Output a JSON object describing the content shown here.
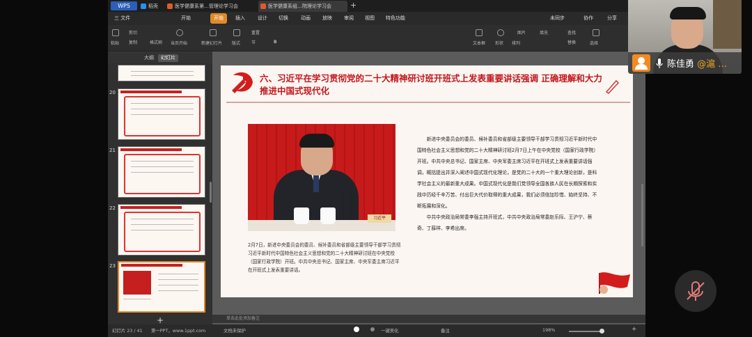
{
  "app_tab": "WPS",
  "tabs": [
    {
      "label": "稻壳",
      "icon_color": "#2b8ef0"
    },
    {
      "label": "医学健康系第…管理论学习会",
      "icon_color": "#e05a2b"
    },
    {
      "label": "医学健康系组…院理论学习会",
      "icon_color": "#e05a2b"
    }
  ],
  "menu": {
    "file": "三  文件",
    "items": [
      "开始",
      "插入",
      "设计",
      "切换",
      "动画",
      "放映",
      "审阅",
      "视图",
      "特色功能"
    ],
    "active": "开始",
    "right": [
      "未同步",
      "协作",
      "分享"
    ]
  },
  "ribbon": {
    "paste": "粘贴",
    "cut": "剪切",
    "copy": "复制",
    "format": "格式刷",
    "play": "当页开始",
    "new_slide": "新建幻灯片",
    "layout": "版式",
    "section": "节",
    "reset": "重置",
    "textbox": "文本框",
    "shape": "形状",
    "arrange": "排列",
    "picture": "图片",
    "fill": "填充",
    "find": "查找",
    "replace": "替换",
    "select": "选择"
  },
  "view_tabs": [
    "大纲",
    "幻灯片"
  ],
  "view_active": "幻灯片",
  "thumbnails": [
    {
      "num": "20"
    },
    {
      "num": "21"
    },
    {
      "num": "22"
    },
    {
      "num": "23"
    }
  ],
  "add_slide": "+",
  "slide": {
    "title": "六、习近平在学习贯彻党的二十大精神研讨班开班式上发表重要讲话强调 正确理解和大力推进中国式现代化",
    "photo_nameplate": "习近平",
    "caption": "2月7日，新进中央委员会的委员、候补委员和省部级主要领导干部学习贯彻习近平新时代中国特色社会主义思想和党的二十大精神研讨班在中央党校（国家行政学院）开班。中共中央总书记、国家主席、中央军委主席习近平在开班式上发表重要讲话。",
    "para1": "新进中央委员会的委员、候补委员和省部级主要领导干部学习贯彻习近平新时代中国特色社会主义思想和党的二十大精神研讨班2月7日上午在中央党校（国家行政学院）开班。中共中央总书记、国家主席、中央军委主席习近平在开班式上发表重要讲话强调，概括提出并深入阐述中国式现代化理论，是党的二十大的一个重大理论创新，是科学社会主义的最新重大成果。中国式现代化是我们党领导全国各族人民在长期探索和实践中历经千辛万苦、付出巨大代价取得的重大成果，我们必须倍加珍惜、始终坚持、不断拓展和深化。",
    "para2": "中共中央政治局常委李强主持开班式，中共中央政治局常委赵乐际、王沪宁、蔡奇、丁薛祥、李希出席。"
  },
  "notes_placeholder": "单击此处添加备注",
  "status": {
    "slide": "幻灯片 23 / 41",
    "theme": "第一PPT，www.1ppt.com",
    "protect": "文档未保护",
    "beautify": "一键美化",
    "notes": "备注",
    "zoom": "198%"
  },
  "participant": {
    "name": "陈佳勇",
    "suffix": "@滬 …"
  },
  "colors": {
    "accent": "#e0892b",
    "title_red": "#c3161c",
    "avatar": "#f28a22"
  }
}
